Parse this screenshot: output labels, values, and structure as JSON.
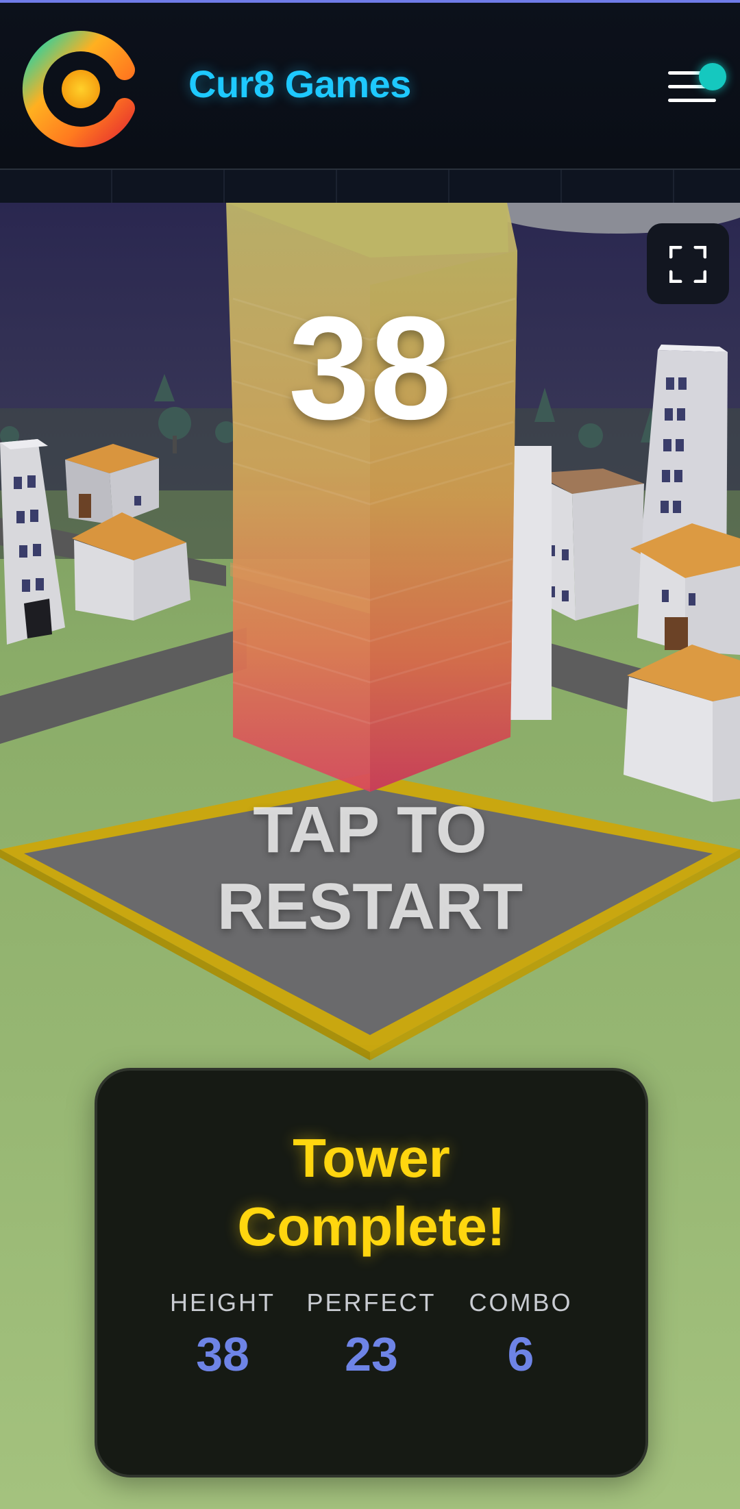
{
  "header": {
    "brand": "Cur8 Games",
    "logo_icon": "cur8-logo-icon",
    "menu_icon": "hamburger-menu-icon",
    "notification_color": "#15c8bf",
    "brand_color": "#1ec9ff"
  },
  "game": {
    "score": "38",
    "restart_line1": "TAP TO",
    "restart_line2": "RESTART",
    "fullscreen_icon": "fullscreen-icon"
  },
  "results": {
    "title_line1": "Tower",
    "title_line2": "Complete!",
    "stats": [
      {
        "label": "HEIGHT",
        "value": "38"
      },
      {
        "label": "PERFECT",
        "value": "23"
      },
      {
        "label": "COMBO",
        "value": "6"
      }
    ],
    "title_color": "#ffd60f",
    "value_color": "#6e84e6"
  }
}
